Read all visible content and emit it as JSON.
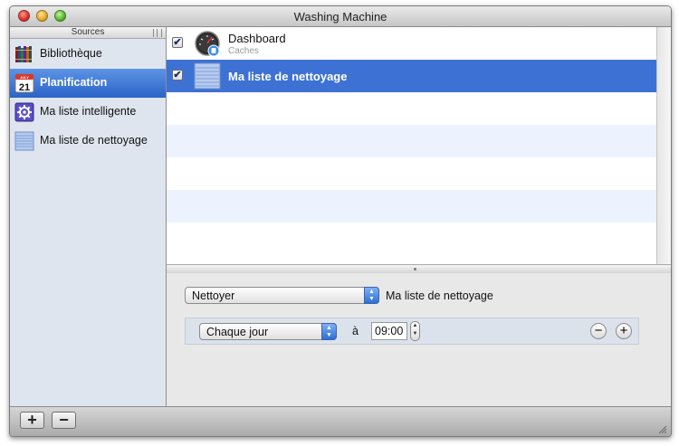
{
  "window": {
    "title": "Washing Machine"
  },
  "sidebar": {
    "header": "Sources",
    "items": [
      {
        "label": "Bibliothèque",
        "icon": "library-books-icon",
        "selected": false
      },
      {
        "label": "Planification",
        "icon": "calendar-icon",
        "calendar_month": "JULY",
        "calendar_day": "21",
        "selected": true
      },
      {
        "label": "Ma liste intelligente",
        "icon": "smart-list-gear-icon",
        "selected": false
      },
      {
        "label": "Ma liste de nettoyage",
        "icon": "cleaning-list-icon",
        "selected": false
      }
    ]
  },
  "schedule_list": {
    "rows": [
      {
        "title": "Dashboard",
        "subtitle": "Caches",
        "checked": true,
        "icon": "dashboard-gauge-icon",
        "selected": false
      },
      {
        "title": "Ma liste de nettoyage",
        "subtitle": "",
        "checked": true,
        "icon": "cleaning-list-icon",
        "selected": true
      }
    ]
  },
  "detail": {
    "action_value": "Nettoyer",
    "action_target": "Ma liste de nettoyage",
    "frequency_value": "Chaque jour",
    "at_label": "à",
    "time_value": "09:00",
    "remove_rule_symbol": "−",
    "add_rule_symbol": "+"
  },
  "bottombar": {
    "add_symbol": "+",
    "remove_symbol": "−"
  },
  "colors": {
    "selection": "#3d72d4",
    "sidebar_bg": "#dfe5ee",
    "alt_row": "#edf3fe"
  }
}
